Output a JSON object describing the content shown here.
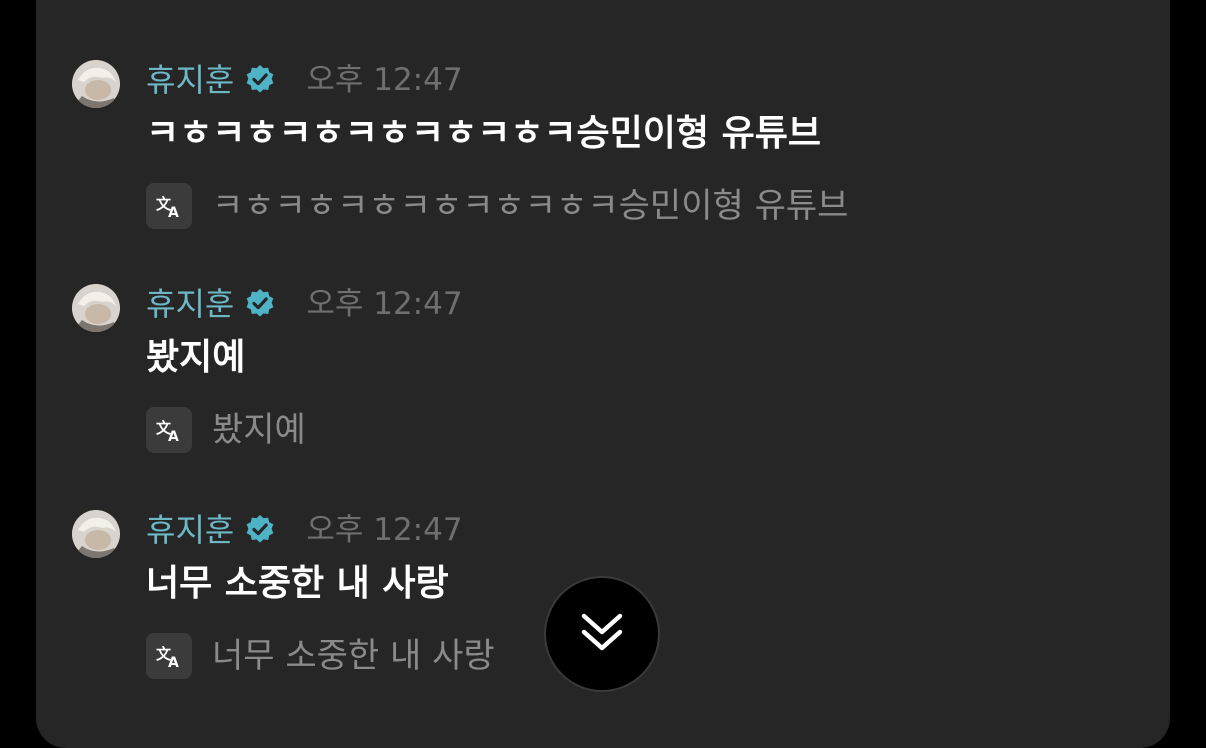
{
  "messages": [
    {
      "author": "휴지훈",
      "time": "오후 12:47",
      "text": "ㅋㅎㅋㅎㅋㅎㅋㅎㅋㅎㅋㅎㅋ승민이형 유튜브",
      "translation": "ㅋㅎㅋㅎㅋㅎㅋㅎㅋㅎㅋㅎㅋ승민이형 유튜브"
    },
    {
      "author": "휴지훈",
      "time": "오후 12:47",
      "text": "봤지예",
      "translation": "봤지예"
    },
    {
      "author": "휴지훈",
      "time": "오후 12:47",
      "text": "너무 소중한 내 사랑",
      "translation": "너무 소중한 내 사랑"
    }
  ],
  "icons": {
    "verified": "verified-badge-icon",
    "translate": "translate-icon",
    "scroll_down": "double-chevron-down-icon"
  },
  "colors": {
    "background": "#262626",
    "author_name": "#6db8c7",
    "verified_badge": "#4fb3c6",
    "timestamp": "#6f6f6f",
    "message_text": "#ffffff",
    "translation_text": "#8a8a8a"
  }
}
